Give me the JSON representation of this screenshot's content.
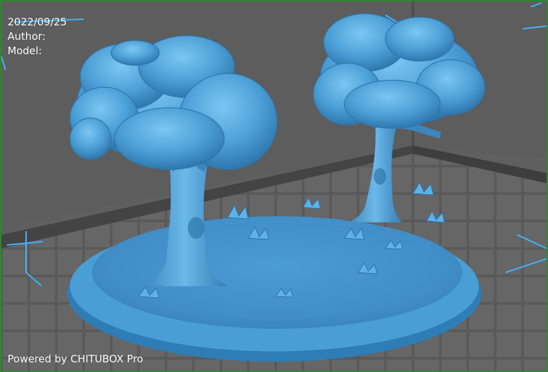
{
  "overlay": {
    "date": "2022/09/25",
    "author_label": "Author:",
    "model_label": "Model:",
    "powered_by": "Powered by CHITUBOX Pro"
  },
  "colors": {
    "background": "#5f5f5f",
    "model": "#4fa8e0",
    "axis": "#3fb4ff",
    "frame": "#2a8a2a"
  },
  "scene": {
    "model_subject": "two-trees-on-oval-base"
  }
}
